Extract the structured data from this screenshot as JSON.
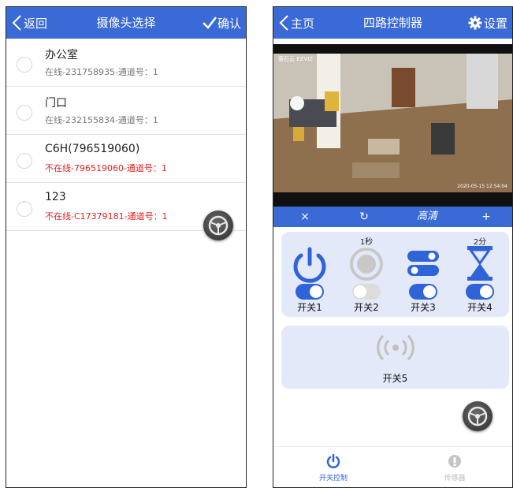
{
  "left_screen": {
    "header": {
      "back_label": "返回",
      "title": "摄像头选择",
      "confirm_label": "确认"
    },
    "cameras": [
      {
        "name": "办公室",
        "status": "在线-231758935-通道号：1",
        "online": true
      },
      {
        "name": "门口",
        "status": "在线-232155834-通道号：1",
        "online": true
      },
      {
        "name": "C6H(796519060)",
        "status": "不在线-796519060-通道号：1",
        "online": false
      },
      {
        "name": "123",
        "status": "不在线-C17379181-通道号：1",
        "online": false
      }
    ]
  },
  "right_screen": {
    "header": {
      "home_label": "主页",
      "title": "四路控制器",
      "settings_label": "设置"
    },
    "video": {
      "timestamp": "2020-05-15 12:54:04",
      "logo_text": "萤石云 EZVIZ"
    },
    "video_controls": {
      "close": "×",
      "refresh": "↻",
      "quality": "高清",
      "add": "+"
    },
    "switches": [
      {
        "label": "开关1",
        "top_text": "",
        "icon": "power-icon",
        "on": true
      },
      {
        "label": "开关2",
        "top_text": "1秒",
        "icon": "push-button-icon",
        "on": false
      },
      {
        "label": "开关3",
        "top_text": "",
        "icon": "toggle-pair-icon",
        "on": true
      },
      {
        "label": "开关4",
        "top_text": "2分",
        "icon": "hourglass-icon",
        "on": true
      }
    ],
    "switch5": {
      "label": "开关5",
      "icon": "wireless-signal-icon"
    },
    "nav": {
      "control_label": "开关控制",
      "sensor_label": "传感器"
    }
  },
  "colors": {
    "primary": "#3a6ad6",
    "offline": "#e02020",
    "panel": "#e3e9f8"
  }
}
